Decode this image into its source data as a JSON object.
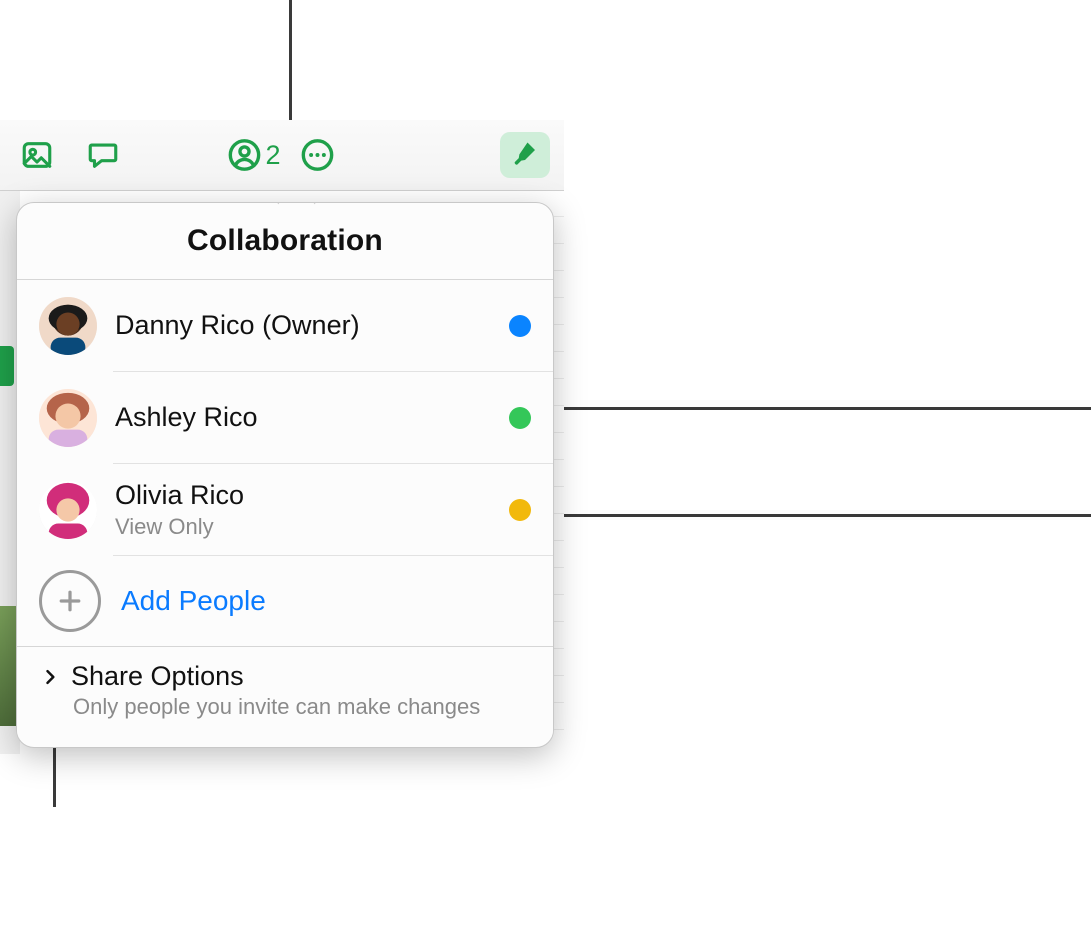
{
  "toolbar": {
    "collab_count": "2"
  },
  "popover": {
    "title": "Collaboration",
    "people": [
      {
        "name": "Danny Rico (Owner)",
        "subtitle": "",
        "dot_color": "#0a84ff"
      },
      {
        "name": "Ashley Rico",
        "subtitle": "",
        "dot_color": "#34c759"
      },
      {
        "name": "Olivia Rico",
        "subtitle": "View Only",
        "dot_color": "#f2b90c"
      }
    ],
    "add_people_label": "Add People",
    "share_options": {
      "title": "Share Options",
      "subtitle": "Only people you invite can make changes"
    }
  },
  "colors": {
    "accent_green": "#1fa04a",
    "link_blue": "#0a7bff"
  }
}
